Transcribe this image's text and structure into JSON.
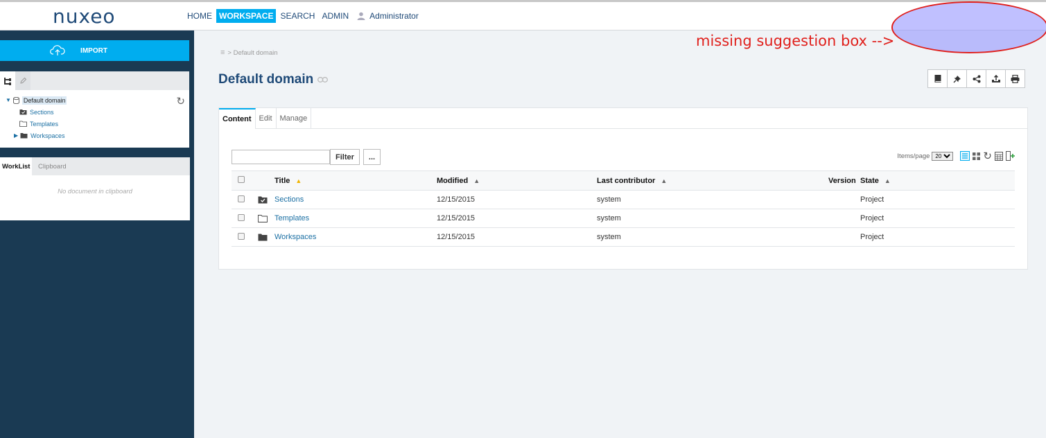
{
  "app": {
    "logo": "nuxeo"
  },
  "nav": {
    "items": [
      "HOME",
      "WORKSPACE",
      "SEARCH",
      "ADMIN"
    ],
    "active": "WORKSPACE",
    "user": "Administrator"
  },
  "annotation": {
    "text": "missing suggestion box -->",
    "color": "#e0201c"
  },
  "sidebar": {
    "import_label": "IMPORT",
    "tree": {
      "root": "Default domain",
      "children": [
        "Sections",
        "Templates",
        "Workspaces"
      ]
    },
    "worklist_tabs": [
      "WorkList",
      "Clipboard"
    ],
    "empty_message": "No document in clipboard"
  },
  "main": {
    "breadcrumb": "> Default domain",
    "title": "Default domain",
    "tabs": [
      "Content",
      "Edit",
      "Manage"
    ],
    "filter_placeholder": "",
    "filter_button": "Filter",
    "more_button": "...",
    "items_per_page_label": "Items/page",
    "items_per_page_value": "20",
    "columns": {
      "title": "Title",
      "modified": "Modified",
      "last_contributor": "Last contributor",
      "version": "Version",
      "state": "State"
    },
    "rows": [
      {
        "title": "Sections",
        "modified": "12/15/2015",
        "contributor": "system",
        "version": "",
        "state": "Project",
        "icon": "sections-folder-icon"
      },
      {
        "title": "Templates",
        "modified": "12/15/2015",
        "contributor": "system",
        "version": "",
        "state": "Project",
        "icon": "templates-folder-icon"
      },
      {
        "title": "Workspaces",
        "modified": "12/15/2015",
        "contributor": "system",
        "version": "",
        "state": "Project",
        "icon": "workspaces-folder-icon"
      }
    ]
  },
  "colors": {
    "accent": "#00adef",
    "sidebar": "#1a3a53",
    "title": "#1f4a78",
    "link": "#1a6fa3"
  }
}
